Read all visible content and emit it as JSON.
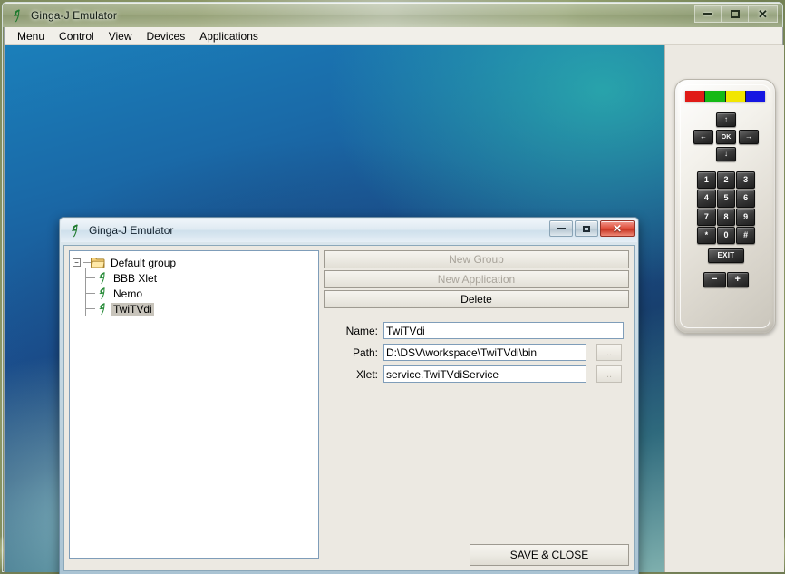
{
  "outer_window": {
    "title": "Ginga-J Emulator",
    "icon": "ginga-leaf-icon",
    "controls": {
      "minimize": "minimize",
      "maximize": "maximize",
      "close": "close"
    }
  },
  "menubar": {
    "items": [
      {
        "label": "Menu"
      },
      {
        "label": "Control"
      },
      {
        "label": "View"
      },
      {
        "label": "Devices"
      },
      {
        "label": "Applications"
      }
    ]
  },
  "remote": {
    "color_keys": [
      {
        "name": "red-key",
        "color": "#e01b17"
      },
      {
        "name": "green-key",
        "color": "#15b915"
      },
      {
        "name": "yellow-key",
        "color": "#f2e600"
      },
      {
        "name": "blue-key",
        "color": "#1516e2"
      }
    ],
    "dpad": {
      "up": "↑",
      "left": "←",
      "ok": "OK",
      "right": "→",
      "down": "↓"
    },
    "keypad": [
      "1",
      "2",
      "3",
      "4",
      "5",
      "6",
      "7",
      "8",
      "9",
      "*",
      "0",
      "#"
    ],
    "exit": "EXIT",
    "volume": {
      "down": "−",
      "up": "+"
    }
  },
  "dialog": {
    "title": "Ginga-J Emulator",
    "icon": "ginga-leaf-icon",
    "controls": {
      "minimize": "minimize",
      "maximize": "maximize",
      "close": "close"
    },
    "tree": {
      "root": {
        "label": "Default group",
        "expanded": true,
        "toggle": "−"
      },
      "children": [
        {
          "label": "BBB Xlet",
          "selected": false
        },
        {
          "label": "Nemo",
          "selected": false
        },
        {
          "label": "TwiTVdi",
          "selected": true
        }
      ]
    },
    "actions": [
      {
        "label": "New Group",
        "enabled": false
      },
      {
        "label": "New Application",
        "enabled": false
      },
      {
        "label": "Delete",
        "enabled": true
      }
    ],
    "form": {
      "name": {
        "label": "Name:",
        "value": "TwiTVdi"
      },
      "path": {
        "label": "Path:",
        "value": "D:\\DSV\\workspace\\TwiTVdi\\bin",
        "browse": ".."
      },
      "xlet": {
        "label": "Xlet:",
        "value": "service.TwiTVdiService",
        "browse": ".."
      }
    },
    "save_close_label": "SAVE & CLOSE"
  }
}
